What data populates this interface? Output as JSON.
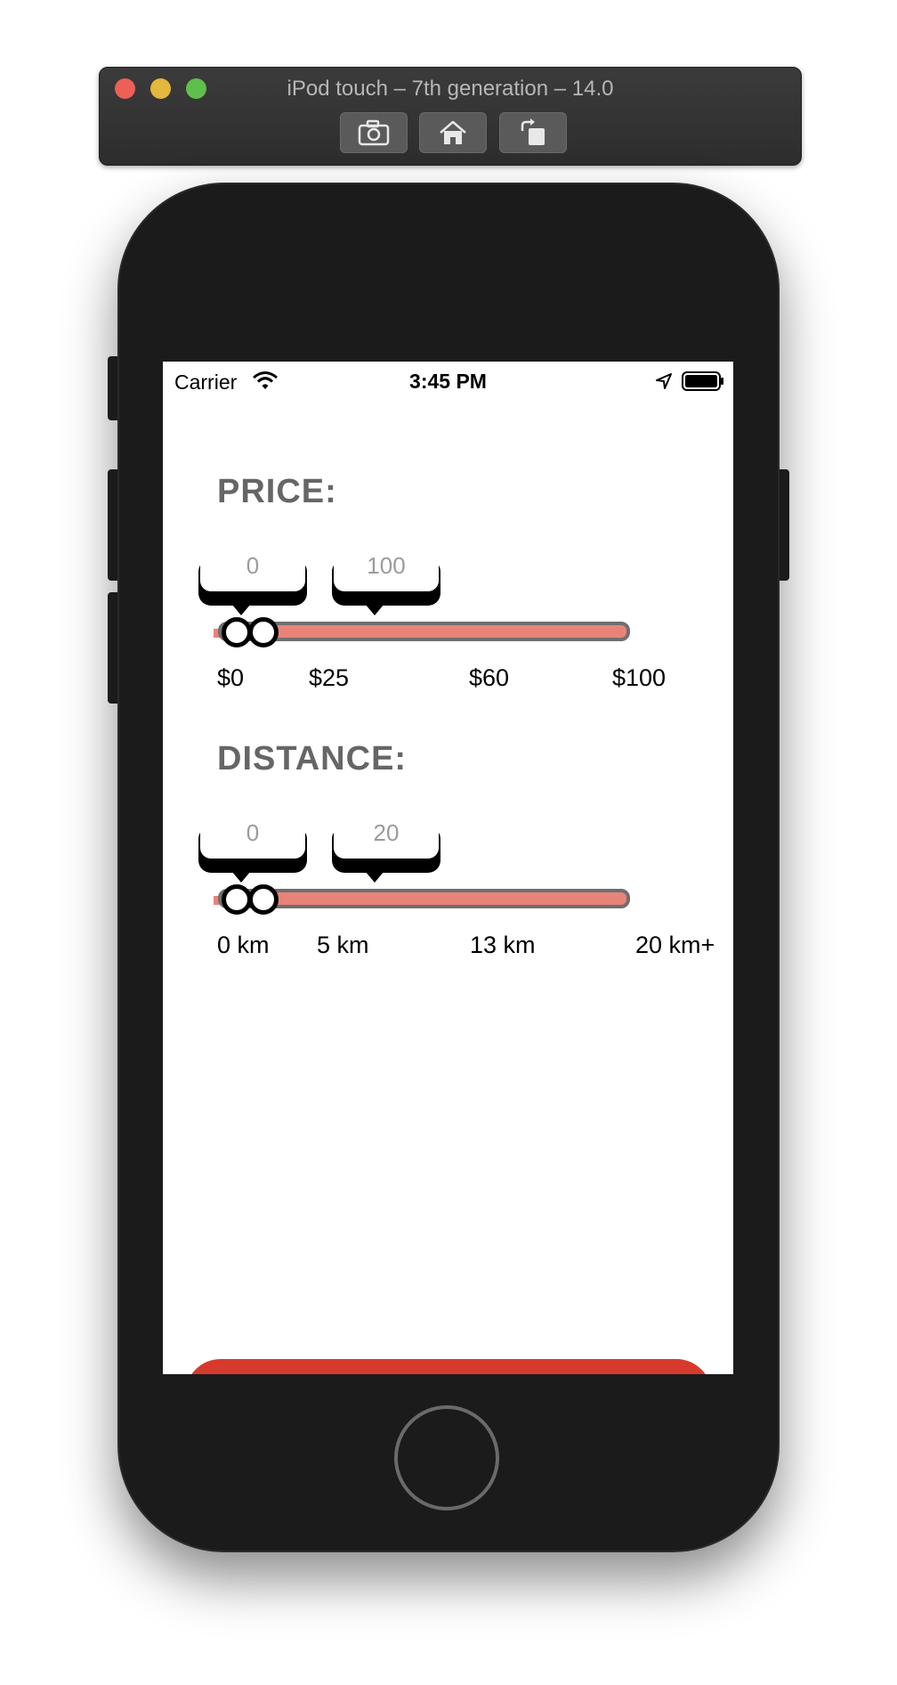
{
  "simulator": {
    "title": "iPod touch – 7th generation – 14.0",
    "toolbar": [
      "screenshot-icon",
      "home-icon",
      "rotate-icon"
    ]
  },
  "status_bar": {
    "carrier": "Carrier",
    "time": "3:45 PM"
  },
  "price": {
    "title": "PRICE:",
    "min_bubble": "0",
    "max_bubble": "100",
    "ticks": [
      "$0",
      "$25",
      "$60",
      "$100"
    ]
  },
  "distance": {
    "title": "DISTANCE:",
    "min_bubble": "0",
    "max_bubble": "20",
    "ticks": [
      "0 km",
      "5 km",
      "13 km",
      "20 km+"
    ]
  },
  "colors": {
    "accent": "#e98379",
    "button": "#d63a2c",
    "title_gray": "#666666"
  }
}
